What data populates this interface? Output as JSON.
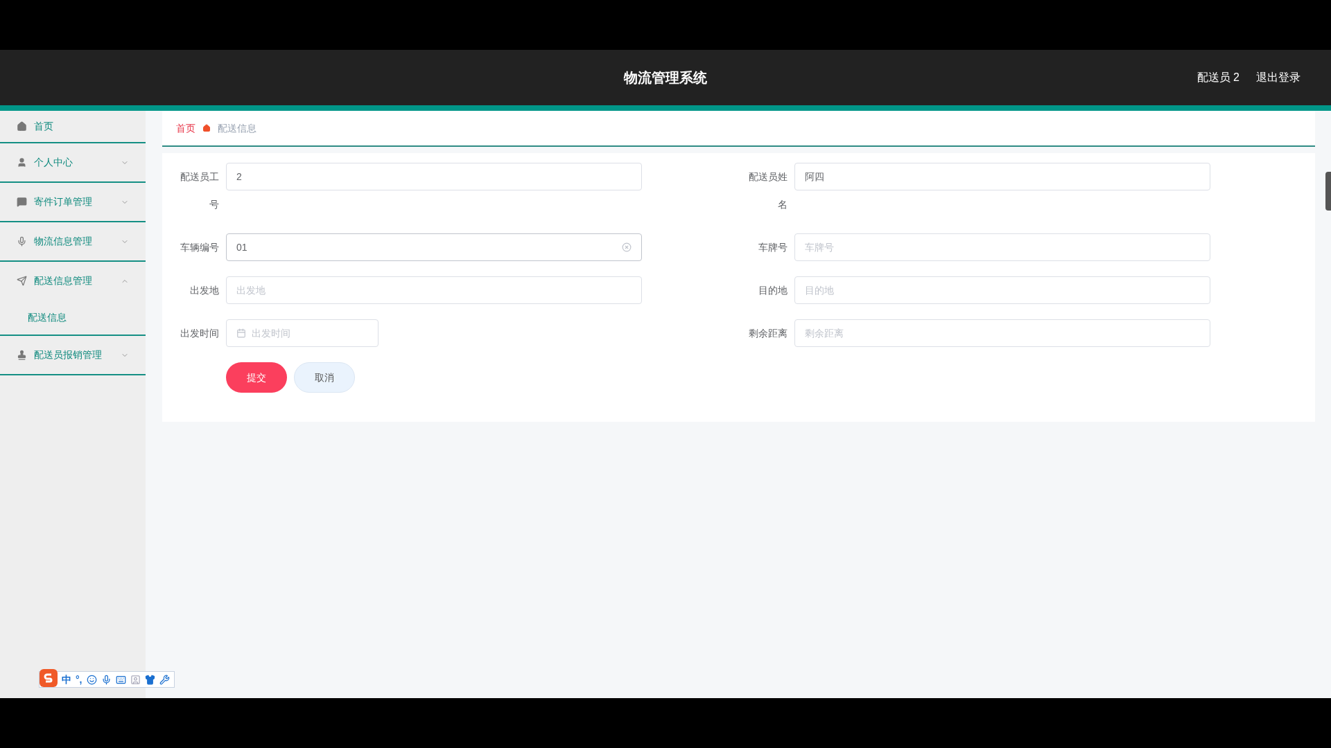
{
  "header": {
    "title": "物流管理系统",
    "user": "配送员 2",
    "logout": "退出登录"
  },
  "sidebar": {
    "items": [
      {
        "label": "首页"
      },
      {
        "label": "个人中心",
        "expanded": false
      },
      {
        "label": "寄件订单管理",
        "expanded": false
      },
      {
        "label": "物流信息管理",
        "expanded": false
      },
      {
        "label": "配送信息管理",
        "expanded": true,
        "children": [
          {
            "label": "配送信息",
            "selected": true
          }
        ]
      },
      {
        "label": "配送员报销管理",
        "expanded": false
      }
    ]
  },
  "breadcrumb": {
    "home": "首页",
    "current": "配送信息"
  },
  "form": {
    "fields": [
      {
        "label": "配送员工号",
        "kind": "text",
        "value": "2",
        "focused": false
      },
      {
        "label": "配送员姓名",
        "kind": "text",
        "value": "阿四",
        "focused": false
      },
      {
        "label": "车辆编号",
        "kind": "text",
        "value": "01",
        "focused": true
      },
      {
        "label": "车牌号",
        "kind": "text",
        "placeholder": "车牌号",
        "focused": false
      },
      {
        "label": "出发地",
        "kind": "text",
        "placeholder": "出发地",
        "focused": false
      },
      {
        "label": "目的地",
        "kind": "text",
        "placeholder": "目的地",
        "focused": false
      },
      {
        "label": "出发时间",
        "kind": "date",
        "placeholder": "出发时间",
        "focused": false
      },
      {
        "label": "剩余距离",
        "kind": "text",
        "placeholder": "剩余距离",
        "focused": false
      }
    ],
    "buttons": [
      {
        "label": "提交",
        "kind": "primary"
      },
      {
        "label": "取消",
        "kind": "secondary"
      }
    ]
  },
  "ime": {
    "mode": "中",
    "punct": "°,"
  }
}
